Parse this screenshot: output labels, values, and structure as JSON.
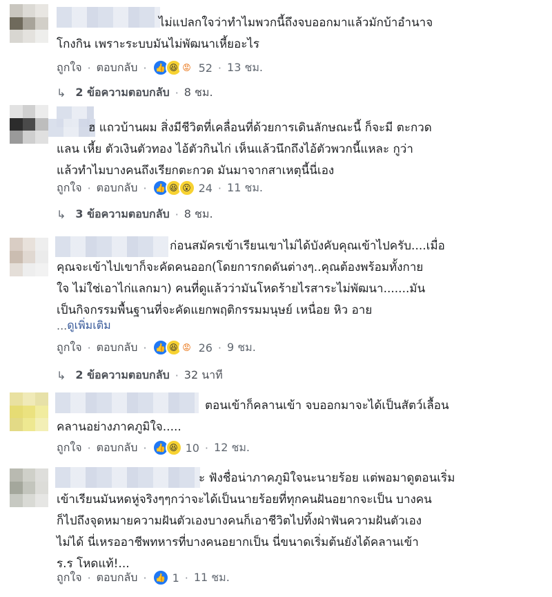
{
  "labels": {
    "like": "ถูกใจ",
    "reply": "ตอบกลับ",
    "separator": "·",
    "see_more": "ดูเพิ่มเติม",
    "see_more_prefix": "... "
  },
  "comments": [
    {
      "text": "ไม่แปลกใจว่าทำไมพวกนี้ถึงจบออกมาแล้วมักบ้าอำนาจ\nโกงกิน เพราะระบบมันไม่พัฒนาเหี้ยอะไร",
      "reactions": [
        "like-icon",
        "haha-icon",
        "angry-icon"
      ],
      "reaction_count": "52",
      "time": "13 ชม.",
      "replies_label": "2 ข้อความตอบกลับ",
      "replies_time": "8 ชม."
    },
    {
      "text": "ฮ แถวบ้านผม สิ่งมีชีวิตที่เคลื่อนที่ด้วยการเดินลักษณะนี้ ก็จะมี ตะกวด\nแลน เหี้ย ตัวเงินตัวทอง ไอ้ตัวกินไก่ เห็นแล้วนึกถึงไอ้ตัวพวกนี้แหละ กูว่า\nแล้วทำไมบางคนถึงเรียกตะกวด มันมาจากสาเหตุนี้นี่เอง",
      "reactions": [
        "like-icon",
        "haha-icon",
        "wow-icon"
      ],
      "reaction_count": "24",
      "time": "11 ชม.",
      "replies_label": "3 ข้อความตอบกลับ",
      "replies_time": "8 ชม."
    },
    {
      "text": "ก่อนสมัครเข้าเรียนเขาไม่ได้บังคับคุณเข้าไปครับ....เมื่อ\nคุณจะเข้าไปเขาก็จะคัดคนออก(โดยการกดดันต่างๆ..คุณต้องพร้อมทั้งกาย\nใจ ไม่ใช่เอาไก่แลกมา) คนที่ดูแล้วว่ามันโหดร้ายไรสาระไม่พัฒนา.......มัน\nเป็นกิจกรรมพื้นฐานที่จะคัดแยกพฤติกรรมมนุษย์ เหนื่อย หิว อาย",
      "reactions": [
        "like-icon",
        "haha-icon",
        "angry-icon"
      ],
      "reaction_count": "26",
      "time": "9 ชม.",
      "replies_label": "2 ข้อความตอบกลับ",
      "replies_time": "32 นาที"
    },
    {
      "text": "ตอนเข้าก็คลานเข้า จบออกมาจะได้เป็นสัตว์เลื้อน\nคลานอย่างภาคภูมิใจ.....",
      "reactions": [
        "like-icon",
        "haha-icon"
      ],
      "reaction_count": "10",
      "time": "12 ชม."
    },
    {
      "text": "ะ ฟังชื่อน่าภาคภูมิใจนะนายร้อย แต่พอมาดูตอนเริ่ม\nเข้าเรียนมันหดหู่จริงๆๆกว่าจะได้เป็นนายร้อยที่ทุกคนฝันอยากจะเป็น บางคน\nก็ไปถึงจุดหมายความฝันตัวเองบางคนก็เอาชีวิตไปทิ้งฝ่าฟันความฝันตัวเอง\nไม่ได้ นี่เหรออาชีพทหารที่บางคนอยากเป็น นี่ขนาดเริ่มต้นยังได้คลานเข้า\nร.ร โหดแท้!...",
      "reactions": [
        "like-icon"
      ],
      "reaction_count": "1",
      "time": "11 ชม."
    }
  ],
  "avatar_colors": [
    [
      "#c9c6bf",
      "#dcdad5",
      "#e8e6e2",
      "#6f6a5c",
      "#a8a49a",
      "#d2cfc8",
      "#d8d6d1",
      "#e4e2de",
      "#eeeeec"
    ],
    [
      "#e2e2e2",
      "#d0d0d0",
      "#ececec",
      "#2c2c2c",
      "#4a4a4a",
      "#bdbdbd",
      "#9a9a9a",
      "#cfcfcf",
      "#e0e0e0"
    ],
    [
      "#d9cdc4",
      "#e8e1db",
      "#eeeeee",
      "#cbbdb1",
      "#e0d8d1",
      "#ebebeb",
      "#e4ded8",
      "#eeeeee",
      "#f2f2f2"
    ],
    [
      "#e9e1a1",
      "#f0eab8",
      "#e7e1a8",
      "#e6dc74",
      "#ebe27f",
      "#f1ec9f",
      "#e3da86",
      "#eee891",
      "#f3efb6"
    ],
    [
      "#b9bab1",
      "#cfd0c9",
      "#dededb",
      "#a4a79c",
      "#c3c5bd",
      "#dcdcd8",
      "#c7c9c2",
      "#d9dad5",
      "#e6e6e4"
    ]
  ]
}
